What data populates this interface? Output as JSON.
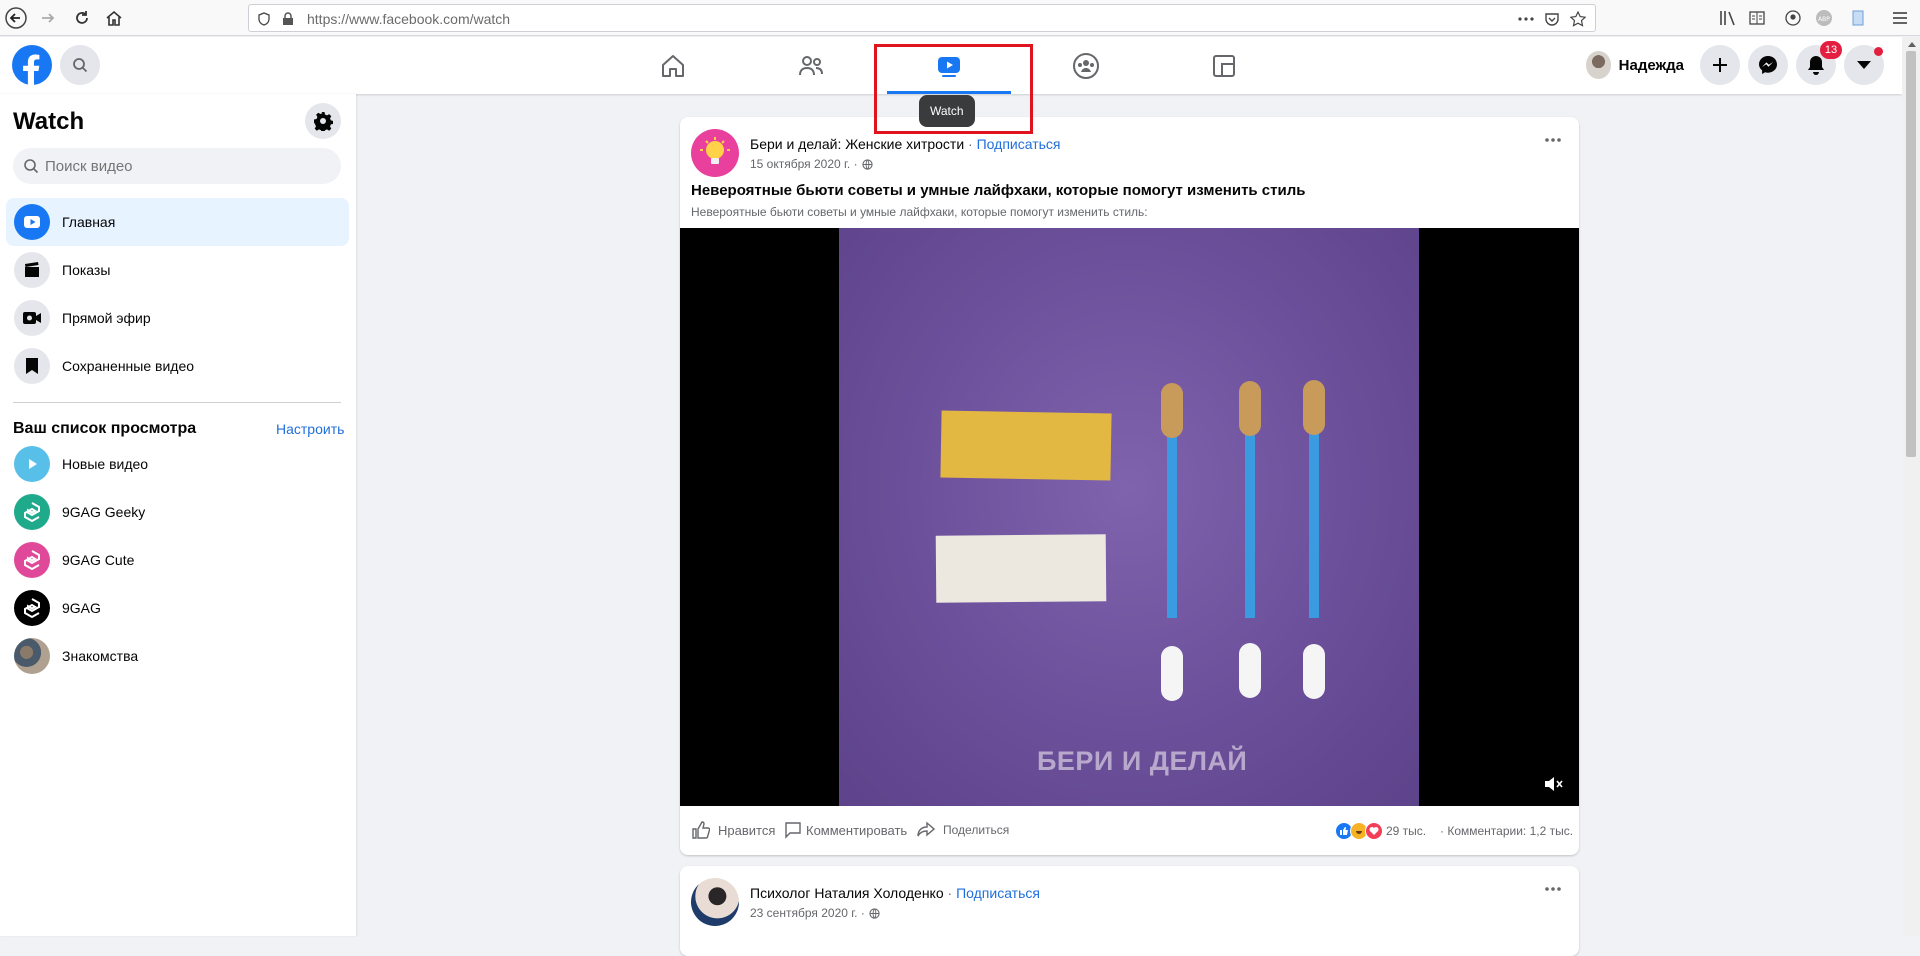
{
  "browser": {
    "url": "https://www.facebook.com/watch"
  },
  "header": {
    "user_name": "Надежда",
    "notifications_count": "13",
    "tooltip": "Watch"
  },
  "sidebar": {
    "title": "Watch",
    "search_placeholder": "Поиск видео",
    "items": [
      {
        "label": "Главная",
        "icon": "watch-play-icon"
      },
      {
        "label": "Показы",
        "icon": "clapper-icon"
      },
      {
        "label": "Прямой эфир",
        "icon": "live-icon"
      },
      {
        "label": "Сохраненные видео",
        "icon": "bookmark-icon"
      }
    ],
    "watchlist_title": "Ваш список просмотра",
    "watchlist_edit": "Настроить",
    "watchlist": [
      {
        "label": "Новые видео"
      },
      {
        "label": "9GAG Geeky"
      },
      {
        "label": "9GAG Cute"
      },
      {
        "label": "9GAG"
      },
      {
        "label": "Знакомства"
      }
    ]
  },
  "posts": [
    {
      "author": "Бери и делай: Женские хитрости",
      "separator": " · ",
      "subscribe": "Подписаться",
      "date": "15 октября 2020 г. ·",
      "title": "Невероятные бьюти советы и умные лайфхаки, которые помогут изменить стиль",
      "description": "Невероятные бьюти советы и умные лайфхаки, которые помогут изменить стиль:",
      "watermark": "БЕРИ И ДЕЛАЙ",
      "like": "Нравится",
      "comment": "Комментировать",
      "share": "Поделиться",
      "reactions_count": "29 тыс.",
      "comments_count": "· Комментарии: 1,2 тыс."
    },
    {
      "author": "Психолог Наталия Холоденко",
      "separator": " · ",
      "subscribe": "Подписаться",
      "date": "23 сентября 2020 г. ·"
    }
  ],
  "colors": {
    "brand": "#1877f2",
    "link": "#216fdb",
    "highlight": "#e0141e"
  }
}
